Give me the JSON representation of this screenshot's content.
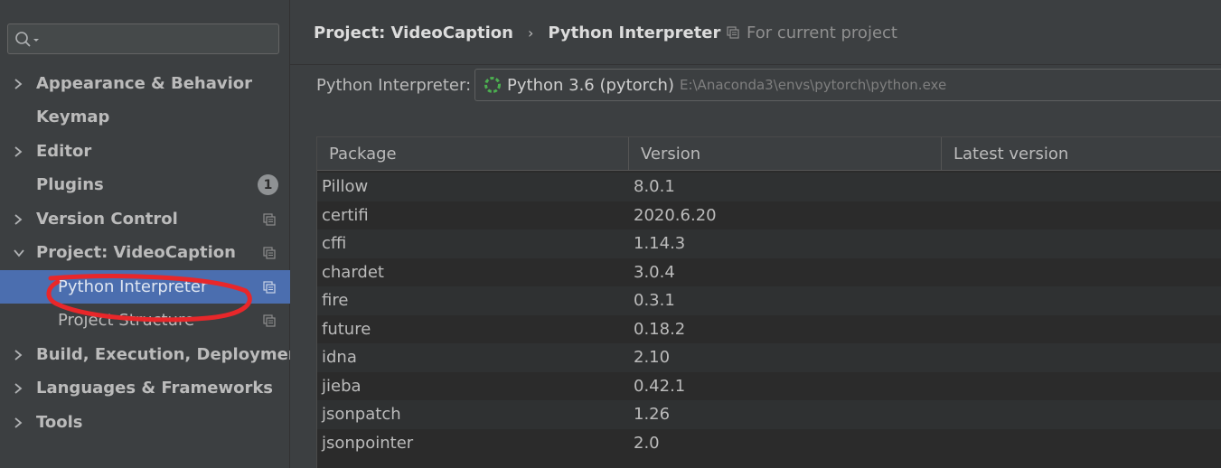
{
  "sidebar": {
    "search": {
      "value": "",
      "placeholder": ""
    },
    "items": [
      {
        "label": "Appearance & Behavior",
        "expandable": true,
        "expanded": false
      },
      {
        "label": "Keymap",
        "expandable": false
      },
      {
        "label": "Editor",
        "expandable": true,
        "expanded": false
      },
      {
        "label": "Plugins",
        "expandable": false,
        "badge": "1"
      },
      {
        "label": "Version Control",
        "expandable": true,
        "expanded": false,
        "copy_icon": true
      },
      {
        "label": "Project: VideoCaption",
        "expandable": true,
        "expanded": true,
        "copy_icon": true
      },
      {
        "label": "Python Interpreter",
        "child": true,
        "selected": true,
        "copy_icon": true
      },
      {
        "label": "Project Structure",
        "child": true,
        "copy_icon": true
      },
      {
        "label": "Build, Execution, Deployment",
        "expandable": true,
        "expanded": false
      },
      {
        "label": "Languages & Frameworks",
        "expandable": true,
        "expanded": false
      },
      {
        "label": "Tools",
        "expandable": true,
        "expanded": false
      }
    ]
  },
  "main": {
    "breadcrumb": [
      "Project: VideoCaption",
      "Python Interpreter"
    ],
    "scope_note": "For current project",
    "interpreter_label": "Python Interpreter:",
    "interpreter_name": "Python 3.6 (pytorch)",
    "interpreter_path": "E:\\Anaconda3\\envs\\pytorch\\python.exe",
    "table": {
      "columns": [
        "Package",
        "Version",
        "Latest version"
      ],
      "rows": [
        {
          "package": "Pillow",
          "version": "8.0.1",
          "latest": ""
        },
        {
          "package": "certifi",
          "version": "2020.6.20",
          "latest": ""
        },
        {
          "package": "cffi",
          "version": "1.14.3",
          "latest": ""
        },
        {
          "package": "chardet",
          "version": "3.0.4",
          "latest": ""
        },
        {
          "package": "fire",
          "version": "0.3.1",
          "latest": ""
        },
        {
          "package": "future",
          "version": "0.18.2",
          "latest": ""
        },
        {
          "package": "idna",
          "version": "2.10",
          "latest": ""
        },
        {
          "package": "jieba",
          "version": "0.42.1",
          "latest": ""
        },
        {
          "package": "jsonpatch",
          "version": "1.26",
          "latest": ""
        },
        {
          "package": "jsonpointer",
          "version": "2.0",
          "latest": ""
        }
      ]
    }
  },
  "colors": {
    "sidebar_bg": "#3c3f41",
    "selection": "#4b6eaf",
    "annotation_stroke": "#e8272a"
  }
}
